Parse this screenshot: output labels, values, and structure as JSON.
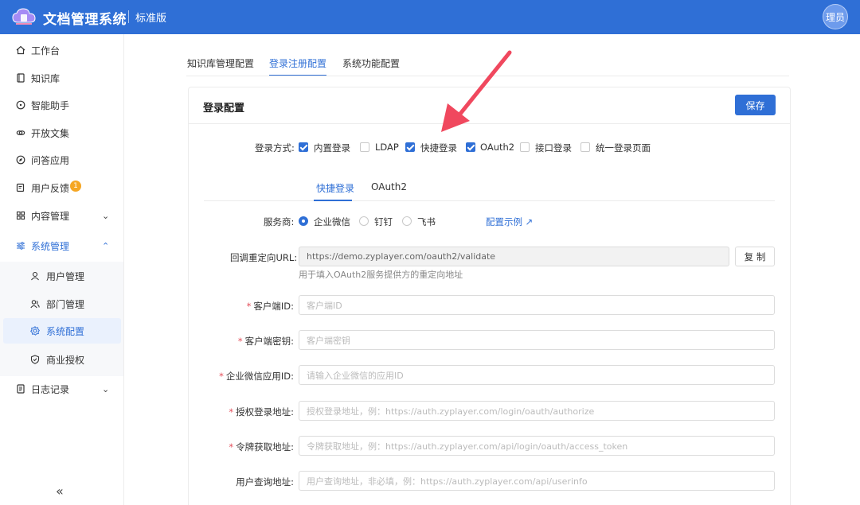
{
  "header": {
    "title": "文档管理系统",
    "edition": "标准版",
    "avatar": "理员"
  },
  "sidebar": {
    "items": [
      {
        "label": "工作台"
      },
      {
        "label": "知识库"
      },
      {
        "label": "智能助手"
      },
      {
        "label": "开放文集"
      },
      {
        "label": "问答应用"
      },
      {
        "label": "用户反馈",
        "badge": "1"
      },
      {
        "label": "内容管理"
      },
      {
        "label": "系统管理"
      },
      {
        "label": "日志记录"
      }
    ],
    "sub_items": [
      {
        "label": "用户管理"
      },
      {
        "label": "部门管理"
      },
      {
        "label": "系统配置"
      },
      {
        "label": "商业授权"
      }
    ],
    "collapse": "«"
  },
  "tabs": [
    "知识库管理配置",
    "登录注册配置",
    "系统功能配置"
  ],
  "card": {
    "title": "登录配置",
    "save_label": "保存"
  },
  "login_methods": {
    "label": "登录方式:",
    "options": [
      {
        "label": "内置登录",
        "checked": true
      },
      {
        "label": "LDAP",
        "checked": false
      },
      {
        "label": "快捷登录",
        "checked": true
      },
      {
        "label": "OAuth2",
        "checked": true
      },
      {
        "label": "接口登录",
        "checked": false
      },
      {
        "label": "统一登录页面",
        "checked": false
      }
    ]
  },
  "inner_tabs": [
    "快捷登录",
    "OAuth2"
  ],
  "provider": {
    "label": "服务商:",
    "options": [
      {
        "label": "企业微信",
        "selected": true
      },
      {
        "label": "钉钉",
        "selected": false
      },
      {
        "label": "飞书",
        "selected": false
      }
    ],
    "example_link": "配置示例"
  },
  "form": {
    "callback_label": "回调重定向URL:",
    "callback_value": "https://demo.zyplayer.com/oauth2/validate",
    "copy_label": "复 制",
    "callback_hint": "用于填入OAuth2服务提供方的重定向地址",
    "fields": [
      {
        "label": "客户端ID:",
        "placeholder": "客户端ID",
        "required": true
      },
      {
        "label": "客户端密钥:",
        "placeholder": "客户端密钥",
        "required": true
      },
      {
        "label": "企业微信应用ID:",
        "placeholder": "请输入企业微信的应用ID",
        "required": true
      },
      {
        "label": "授权登录地址:",
        "placeholder": "授权登录地址，例：https://auth.zyplayer.com/login/oauth/authorize",
        "required": true
      },
      {
        "label": "令牌获取地址:",
        "placeholder": "令牌获取地址，例：https://auth.zyplayer.com/api/login/oauth/access_token",
        "required": true
      },
      {
        "label": "用户查询地址:",
        "placeholder": "用户查询地址，非必填，例：https://auth.zyplayer.com/api/userinfo",
        "required": false
      }
    ]
  },
  "colors": {
    "primary": "#2f6fd6",
    "arrow": "#f0485e",
    "badge": "#f5a623"
  }
}
